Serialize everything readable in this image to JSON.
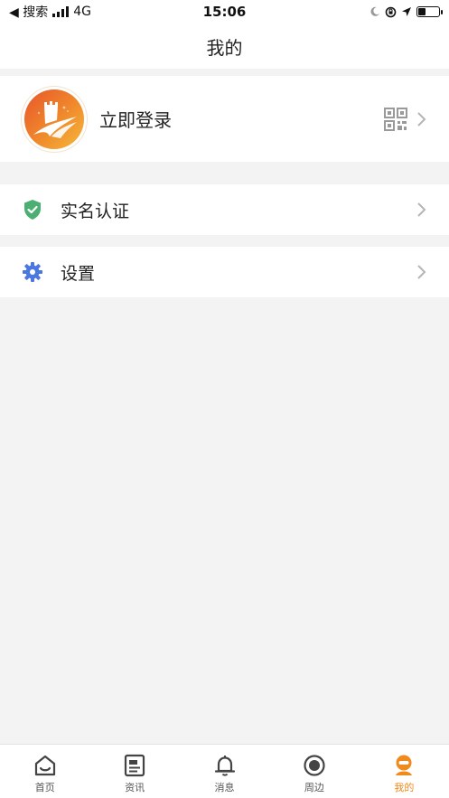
{
  "status_bar": {
    "back_app": "◀ 搜索",
    "network": "4G",
    "time": "15:06"
  },
  "header": {
    "title": "我的"
  },
  "profile": {
    "login_label": "立即登录"
  },
  "menu": {
    "items": [
      {
        "label": "实名认证",
        "icon": "shield-check-icon",
        "icon_color": "#4caf72"
      },
      {
        "label": "设置",
        "icon": "gear-icon",
        "icon_color": "#4a78e0"
      }
    ]
  },
  "tab_bar": {
    "active_color": "#f08a1c",
    "tabs": [
      {
        "label": "首页",
        "icon": "home-icon"
      },
      {
        "label": "资讯",
        "icon": "news-icon"
      },
      {
        "label": "消息",
        "icon": "bell-icon"
      },
      {
        "label": "周边",
        "icon": "nearby-icon"
      },
      {
        "label": "我的",
        "icon": "profile-icon",
        "active": true
      }
    ]
  },
  "colors": {
    "background": "#f3f3f3",
    "card": "#ffffff",
    "accent": "#f08a1c"
  }
}
